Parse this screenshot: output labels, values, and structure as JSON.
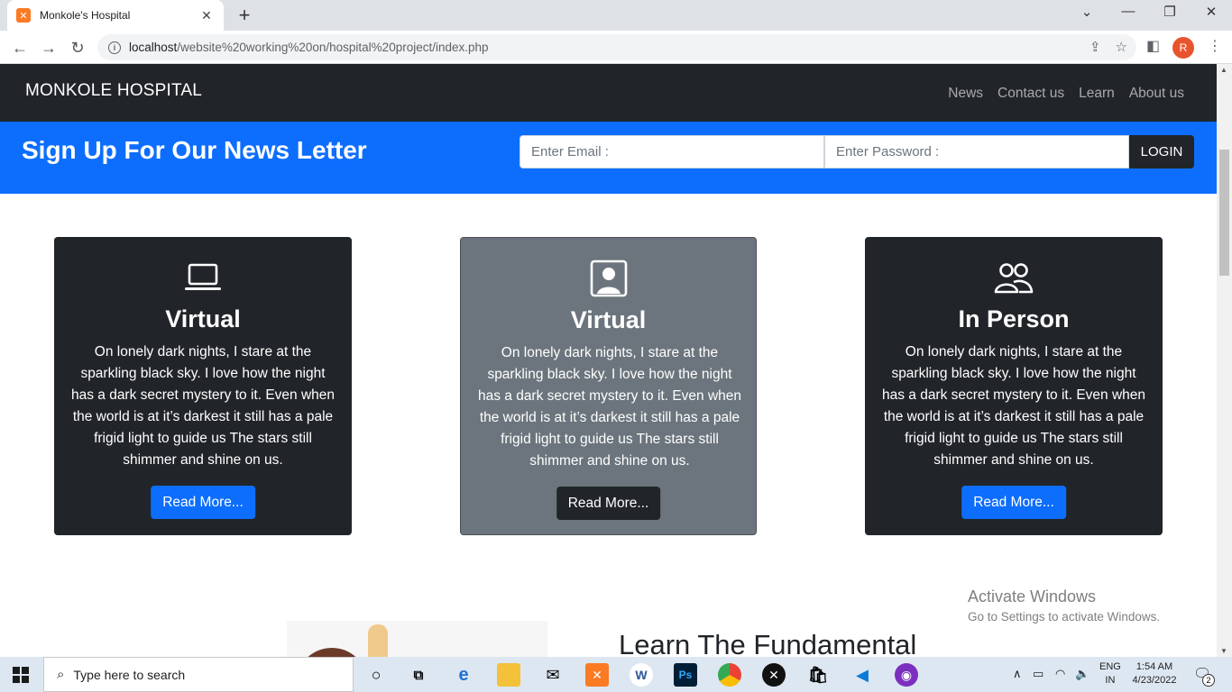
{
  "browser": {
    "tab_title": "Monkole's Hospital",
    "tab_favicon": "xampp-icon",
    "url_host": "localhost",
    "url_path": "/website%20working%20on/hospital%20project/index.php",
    "profile_initial": "R"
  },
  "site": {
    "brand": "MONKOLE HOSPITAL",
    "nav": [
      "News",
      "Contact us",
      "Learn",
      "About us"
    ]
  },
  "newsletter": {
    "title": "Sign Up For Our News Letter",
    "email_placeholder": "Enter Email :",
    "password_placeholder": "Enter Password :",
    "button": "LOGIN"
  },
  "cards": [
    {
      "icon": "laptop-icon",
      "title": "Virtual",
      "text": "On lonely dark nights, I stare at the sparkling black sky. I love how the night has a dark secret mystery to it. Even when the world is at it’s darkest it still has a pale frigid light to guide us The stars still shimmer and shine on us.",
      "button": "Read More..."
    },
    {
      "icon": "person-square-icon",
      "title": "Virtual",
      "text": "On lonely dark nights, I stare at the sparkling black sky. I love how the night has a dark secret mystery to it. Even when the world is at it’s darkest it still has a pale frigid light to guide us The stars still shimmer and shine on us.",
      "button": "Read More..."
    },
    {
      "icon": "people-icon",
      "title": "In Person",
      "text": "On lonely dark nights, I stare at the sparkling black sky. I love how the night has a dark secret mystery to it. Even when the world is at it’s darkest it still has a pale frigid light to guide us The stars still shimmer and shine on us.",
      "button": "Read More..."
    }
  ],
  "learn": {
    "title": "Learn The Fundamental"
  },
  "watermark": {
    "title": "Activate Windows",
    "subtitle": "Go to Settings to activate Windows."
  },
  "taskbar": {
    "search_placeholder": "Type here to search",
    "lang_line1": "ENG",
    "lang_line2": "IN",
    "time": "1:54 AM",
    "date": "4/23/2022",
    "notification_count": "2"
  },
  "colors": {
    "primary": "#0d6efd",
    "dark": "#212529",
    "secondary": "#6c757d"
  }
}
